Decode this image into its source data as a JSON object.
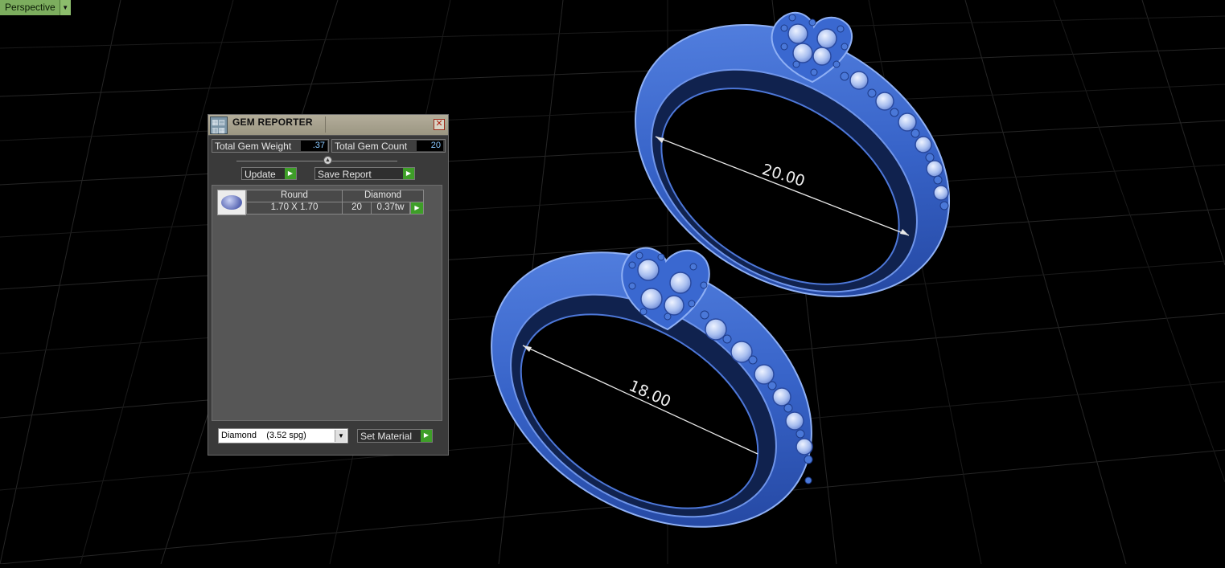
{
  "viewport": {
    "label": "Perspective",
    "dimension_upper": "20.00",
    "dimension_lower": "18.00",
    "colors": {
      "ring": "#3d6ed3",
      "grid": "#2a2a2a",
      "label_bg": "#7cad5e"
    }
  },
  "panel": {
    "title": "GEM REPORTER",
    "close_icon": "close-icon",
    "total_weight_label": "Total Gem Weight",
    "total_weight_value": ".37",
    "total_count_label": "Total Gem Count",
    "total_count_value": "20",
    "update_label": "Update",
    "save_report_label": "Save Report",
    "gem_rows": [
      {
        "shape": "Round",
        "material": "Diamond",
        "size": "1.70 X 1.70",
        "count": "20",
        "weight": "0.37tw"
      }
    ],
    "material_select": "Diamond    (3.52 spg)",
    "set_material_label": "Set Material",
    "accent_green": "#3e9e28"
  }
}
